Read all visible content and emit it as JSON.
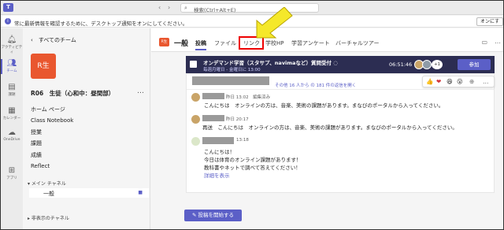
{
  "titlebar": {
    "search_placeholder": "検索(Ctrl+Alt+E)",
    "nav_back": "‹",
    "nav_forward": "›"
  },
  "banner": {
    "text": "常に最新情報を確認するために、デスクトップ通知をオンにしてください。",
    "button": "オンにす"
  },
  "rail": [
    {
      "label": "アクティビティ",
      "icon": "bell-icon"
    },
    {
      "label": "チーム",
      "icon": "teams-icon"
    },
    {
      "label": "課題",
      "icon": "assignments-icon"
    },
    {
      "label": "カレンダー",
      "icon": "calendar-icon"
    },
    {
      "label": "OneDrive",
      "icon": "onedrive-icon"
    },
    {
      "label": "アプリ",
      "icon": "apps-icon"
    }
  ],
  "sidebar": {
    "back_label": "すべてのチーム",
    "team_avatar": "R生",
    "team_name": "R06　生徒（心和中：昼間部）",
    "more": "…",
    "nav": [
      "ホーム ページ",
      "Class Notebook",
      "授業",
      "課題",
      "成績",
      "Reflect"
    ],
    "main_channels_label": "メイン チャネル",
    "channel": "一般",
    "hidden_channels_label": "非表示のチャネル"
  },
  "main": {
    "channel_icon": "R生",
    "channel_title": "一般",
    "tabs": [
      "投稿",
      "ファイル",
      "リンク",
      "学校HP",
      "学習アンケート",
      "バーチャルツアー"
    ],
    "more": "…",
    "meeting": {
      "title": "オンデマンド学習（スタサプ、navimaなど）質問受付 ◌",
      "subtitle": "毎週月曜日 - 金曜日に 13:00",
      "elapsed": "06:51:46",
      "participant_count": "+1",
      "join_label": "参加"
    },
    "hidden_replies": "その他 16 人から の 181 件の返信を開く",
    "reactions": [
      "👍",
      "❤",
      "😆",
      "😮",
      "⊕",
      "…"
    ],
    "replies": [
      {
        "meta": "昨日 13:02　編集済み",
        "text": "こんにちは　オンラインの方は、音楽、美術の課題があります。まなびのポータルから入ってください。"
      },
      {
        "meta": "昨日 20:17",
        "text": "再送　こんにちは　オンラインの方は、音楽、美術の課題があります。まなびのポータルから入ってください。"
      },
      {
        "meta": "13:18",
        "lines": [
          "こんにちは！",
          "今日は体育のオンライン課題があります！",
          "教科書やネットで調べて答えてください！"
        ],
        "link": "詳細を表示"
      }
    ],
    "new_post_label": "投稿を開始する"
  }
}
